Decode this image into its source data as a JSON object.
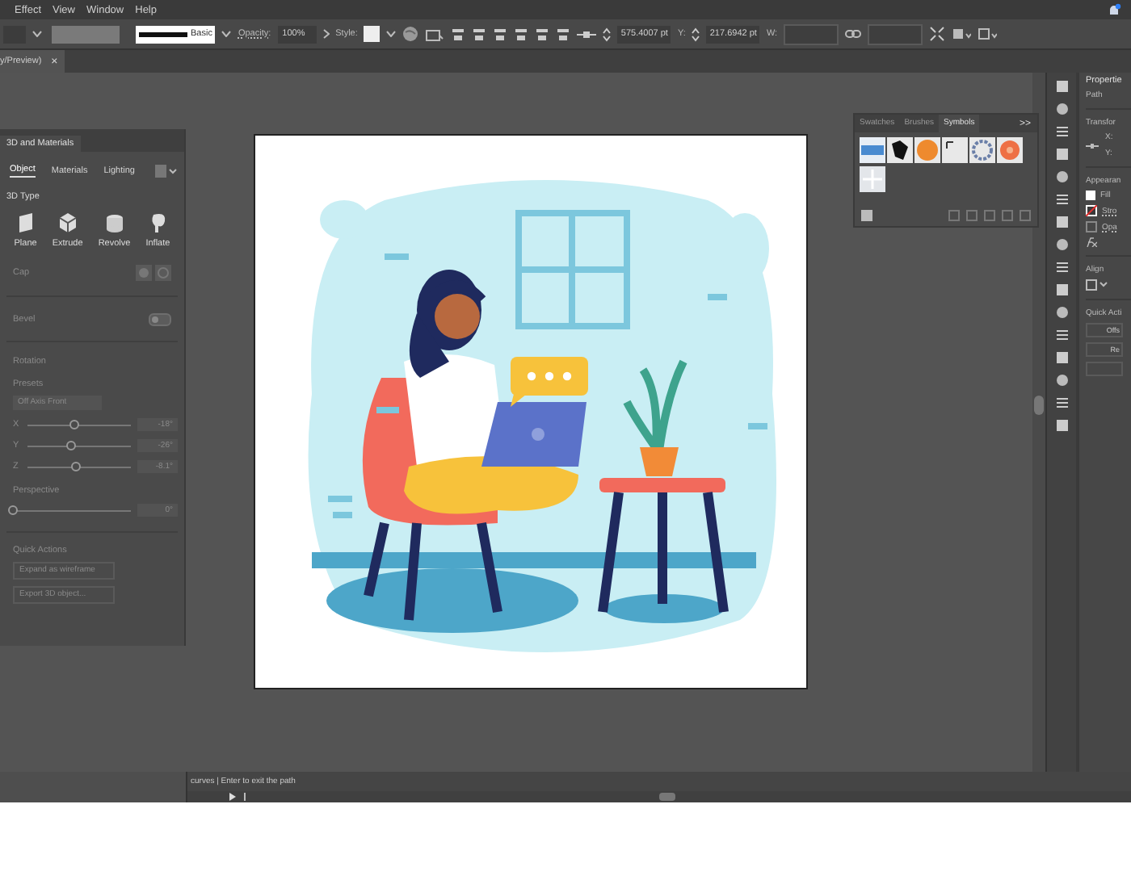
{
  "menu_bar": [
    "Effect",
    "View",
    "Window",
    "Help"
  ],
  "control_bar": {
    "stroke_style": "Basic",
    "opacity_label": "Opacity:",
    "opacity": "100%",
    "style_label": "Style:",
    "x_value": "575.4007 pt",
    "y_label": "Y:",
    "y_value": "217.6942 pt",
    "w_label": "W:"
  },
  "document_tab": {
    "title": "y/Preview)",
    "close": "×"
  },
  "panel_3d": {
    "title": "3D and Materials",
    "tabs": [
      {
        "label": "Object",
        "selected": true
      },
      {
        "label": "Materials",
        "selected": false
      },
      {
        "label": "Lighting",
        "selected": false
      }
    ],
    "type_heading": "3D Type",
    "types": [
      {
        "label": "Plane",
        "kind": "plane"
      },
      {
        "label": "Extrude",
        "kind": "extrude"
      },
      {
        "label": "Revolve",
        "kind": "revolve"
      },
      {
        "label": "Inflate",
        "kind": "inflate"
      }
    ],
    "cap_label": "Cap",
    "bevel": {
      "label": "Bevel",
      "on": false
    },
    "rotation_heading": "Rotation",
    "presets_label": "Presets",
    "preset": "Off Axis Front",
    "axes": [
      {
        "label": "X",
        "level": 0.45,
        "value": "-18°"
      },
      {
        "label": "Y",
        "level": 0.42,
        "value": "-26°"
      },
      {
        "label": "Z",
        "level": 0.47,
        "value": "-8.1°"
      }
    ],
    "perspective": {
      "label": "Perspective",
      "level": 0,
      "value": "0°"
    },
    "quick_actions_heading": "Quick Actions",
    "buttons": [
      "Expand as wireframe",
      "Export 3D object..."
    ]
  },
  "symbols_panel": {
    "tabs": [
      {
        "label": "Swatches",
        "selected": false
      },
      {
        "label": "Brushes",
        "selected": false
      },
      {
        "label": "Symbols",
        "selected": true
      }
    ],
    "menu": ">>"
  },
  "properties_panel": {
    "title": "Propertie",
    "object": "Path",
    "transform": "Transfor",
    "x_label": "X:",
    "y_label": "Y:",
    "appearance": "Appearan",
    "fill": "Fill",
    "stroke": "Stro",
    "opacity": "Opa",
    "align": "Align",
    "quick_actions": "Quick Acti",
    "buttons": [
      "Offs",
      "Re"
    ]
  },
  "status_bar": {
    "text": "curves  |  Enter to exit the path"
  }
}
